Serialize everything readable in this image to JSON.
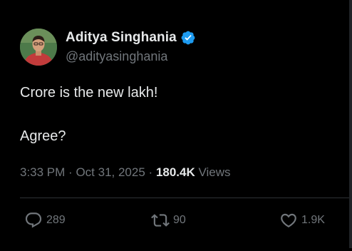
{
  "author": {
    "display_name": "Aditya Singhania",
    "handle": "@adityasinghania",
    "verified": true
  },
  "tweet": {
    "lines": [
      "Crore is the new lakh!",
      "Agree?"
    ],
    "time": "3:33 PM",
    "date": "Oct 31, 2025",
    "separator": "·",
    "views_count": "180.4K",
    "views_label": "Views"
  },
  "actions": {
    "replies": "289",
    "retweets": "90",
    "likes": "1.9K"
  },
  "colors": {
    "background": "#000000",
    "text_primary": "#e7e9ea",
    "text_secondary": "#71767b",
    "verified_blue": "#1d9bf0",
    "divider": "#2f3336"
  },
  "icons": {
    "verified": "verified-badge-icon",
    "reply": "comment-bubble-icon",
    "retweet": "retweet-arrows-icon",
    "like": "heart-icon"
  }
}
